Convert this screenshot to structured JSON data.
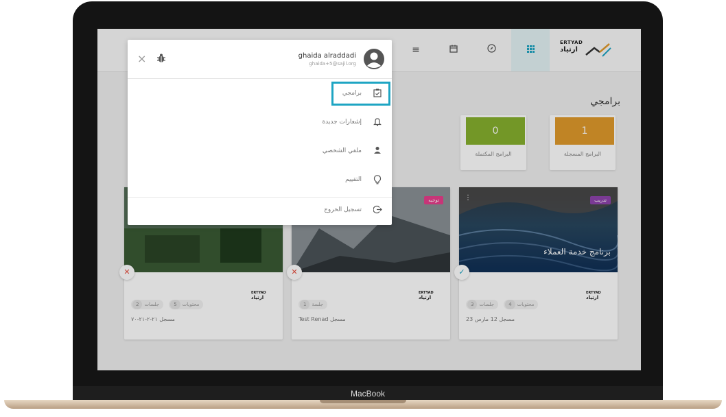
{
  "device": {
    "brand_label": "MacBook"
  },
  "app": {
    "logo_en": "ERTYAD",
    "logo_ar": "ارتياد",
    "page_title": "برامجي",
    "colors": {
      "accent": "#1ea5c3",
      "registered": "#e09a2c",
      "completed": "#86b02e",
      "badge_pink": "#e83e8c",
      "badge_purple": "#8e44ad"
    }
  },
  "topbar": {
    "icons": [
      "menu-icon",
      "calendar-icon",
      "compass-icon",
      "grid-icon"
    ]
  },
  "stats": [
    {
      "value": "1",
      "label": "البرامج المسجلة"
    },
    {
      "value": "0",
      "label": "البرامج المكتملة"
    }
  ],
  "user_menu": {
    "name": "ghaida alraddadi",
    "email": "ghaida+5@sajil.org",
    "items": [
      {
        "label": "برامجي",
        "icon": "clipboard-check-icon"
      },
      {
        "label": "إشعارات جديدة",
        "icon": "bell-icon"
      },
      {
        "label": "ملفي الشخصي",
        "icon": "person-icon"
      },
      {
        "label": "التقييم",
        "icon": "lightbulb-icon"
      },
      {
        "label": "تسجيل الخروج",
        "icon": "logout-icon"
      }
    ]
  },
  "cards": [
    {
      "badge": "تدريب",
      "title": "برنامج خدمة العملاء",
      "status": "✓",
      "pills": [
        {
          "n": "3",
          "t": "جلسات"
        },
        {
          "n": "4",
          "t": "محتويات"
        }
      ],
      "meta": "مسجل 12 مارس 23"
    },
    {
      "badge": "توجيه",
      "title": "",
      "status": "✕",
      "pills": [
        {
          "n": "1",
          "t": "جلسة"
        }
      ],
      "meta": "Test Renad مسجل"
    },
    {
      "badge": "",
      "title": "",
      "status": "✕",
      "pills": [
        {
          "n": "2",
          "t": "جلسات"
        },
        {
          "n": "5",
          "t": "محتويات"
        }
      ],
      "meta": "مسجل ٢١-٢-٢١-٧٠"
    }
  ]
}
